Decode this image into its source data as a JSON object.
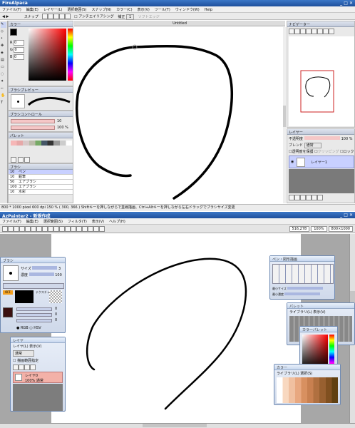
{
  "top": {
    "title": "FireAlpaca",
    "menu": [
      "ファイル(F)",
      "編集(E)",
      "レイヤー(L)",
      "選択範囲(S)",
      "スナップ(N)",
      "カラー(C)",
      "表示(V)",
      "ツール(T)",
      "ウィンドウ(W)",
      "Help"
    ],
    "toolbar": {
      "snap": "スナップ",
      "antialias": "アンチエイリアシング",
      "correction_label": "補正",
      "correction_value": "1",
      "soft_edge": "ソフトエッジ"
    },
    "tab_label": "Untitled",
    "color_panel": {
      "title": "カラー",
      "r": "0",
      "g": "0",
      "b": "0"
    },
    "brush_preview": {
      "title": "ブラシプレビュー"
    },
    "brush_control": {
      "title": "ブラシコントロール",
      "size": "10",
      "opacity": "100 %"
    },
    "palette": {
      "title": "パレット"
    },
    "brush": {
      "title": "ブラシ",
      "items": [
        {
          "size": "10",
          "name": "ペン"
        },
        {
          "size": "10",
          "name": "鉛筆"
        },
        {
          "size": "50",
          "name": "エアブラシ"
        },
        {
          "size": "100",
          "name": "エアブラシ"
        },
        {
          "size": "10",
          "name": "水彩"
        }
      ]
    },
    "navigator": {
      "title": "ナビゲーター"
    },
    "layer": {
      "title": "レイヤー",
      "opacity_label": "不透明度",
      "opacity": "100 %",
      "blend_label": "ブレンド",
      "blend": "通常",
      "protect": "透明度を保護",
      "clipping": "クリッピング",
      "lock": "ロック",
      "layer_name": "レイヤー1"
    },
    "status": "800 * 1000 pixel  600 dpi   150 %   ( 300, 366 )   Shiftキーを押しながらで直線描画、Ctrl+Altキーを押しながら左右ドラッグでブラシサイズ変更"
  },
  "bottom": {
    "title": "AzPainter2 - 新規作成",
    "menu": [
      "ファイル(F)",
      "編集(E)",
      "選択範囲(S)",
      "フィルタ(T)",
      "表示(V)",
      "ヘルプ(H)"
    ],
    "status_cells": [
      "516,278",
      "100%",
      "800×1000"
    ],
    "brush_window": {
      "title": "ブラシ",
      "size_label": "サイズ",
      "size": "3",
      "density_label": "濃度",
      "density": "100",
      "texture_label": "テクスチャ",
      "off": "OFF"
    },
    "color_window": {
      "rgb": "RGB",
      "hsv": "HSV",
      "r": "0",
      "g": "0",
      "b": "0"
    },
    "layer_window": {
      "title": "レイヤ",
      "menu": "レイヤ(L)  表示(V)",
      "mode": "通常",
      "mask": "描画範囲指定",
      "layer_name": "レイヤ0",
      "layer_info": "100% 通常"
    },
    "tool_window": {
      "title": "ペン・図形描画",
      "size_label": "最小サイズ",
      "density_label": "最小濃度"
    },
    "palette_window": {
      "title": "パレット",
      "menu": "ライブラリ(L)  表示(V)"
    },
    "colorpick_window": {
      "title": "カラーパレット"
    },
    "swatch_window": {
      "title": "カラー",
      "menu": "ライブラリ(L)  選択(S)"
    }
  },
  "colors": {
    "accent": "#3b6fc2",
    "red": "#cc0000"
  }
}
